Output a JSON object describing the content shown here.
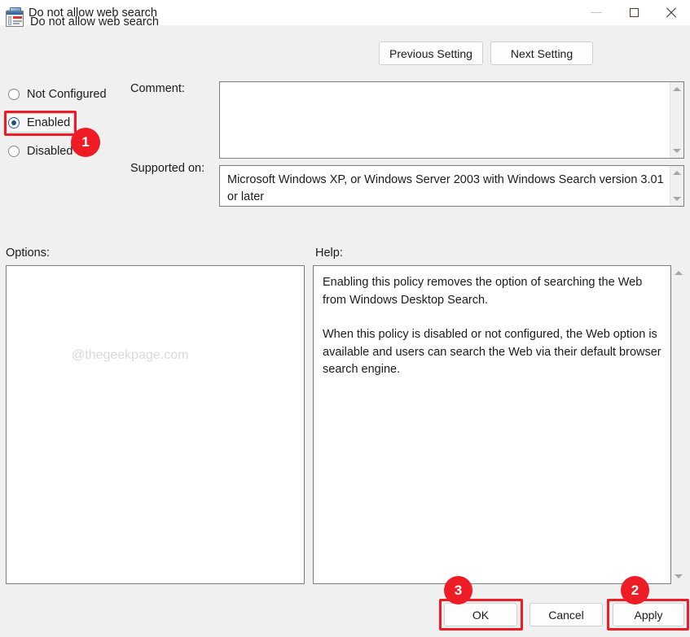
{
  "window": {
    "title": "Do not allow web search",
    "icon": "policy-monitor-icon",
    "controls": {
      "minimize": "minimize-icon",
      "maximize": "maximize-icon",
      "close": "close-icon"
    }
  },
  "header": {
    "title": "Do not allow web search",
    "icon": "setting-icon",
    "previous_setting_label": "Previous Setting",
    "next_setting_label": "Next Setting"
  },
  "state_options": {
    "not_configured_label": "Not Configured",
    "enabled_label": "Enabled",
    "disabled_label": "Disabled",
    "selected": "Enabled"
  },
  "comment": {
    "label": "Comment:",
    "value": ""
  },
  "supported_on": {
    "label": "Supported on:",
    "value": "Microsoft Windows XP, or Windows Server 2003 with Windows Search version 3.01 or later"
  },
  "options": {
    "label": "Options:",
    "value": "",
    "watermark": "@thegeekpage.com"
  },
  "help": {
    "label": "Help:",
    "paragraph_1": "Enabling this policy removes the option of searching the Web from Windows Desktop Search.",
    "paragraph_2": "When this policy is disabled or not configured, the Web option is available and users can search the Web via their default browser search engine."
  },
  "footer": {
    "ok_label": "OK",
    "cancel_label": "Cancel",
    "apply_label": "Apply"
  },
  "annotations": {
    "color": "#ee1c25",
    "step_1": "1",
    "step_2": "2",
    "step_3": "3"
  }
}
